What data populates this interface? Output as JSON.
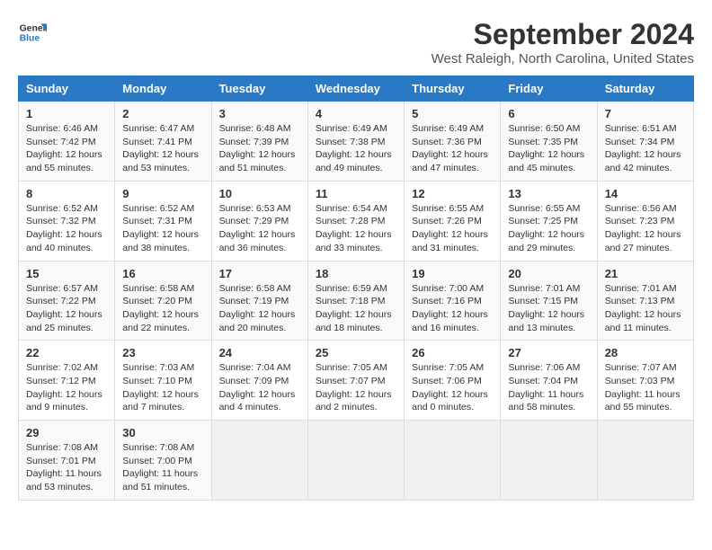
{
  "header": {
    "logo_line1": "General",
    "logo_line2": "Blue",
    "month": "September 2024",
    "location": "West Raleigh, North Carolina, United States"
  },
  "weekdays": [
    "Sunday",
    "Monday",
    "Tuesday",
    "Wednesday",
    "Thursday",
    "Friday",
    "Saturday"
  ],
  "weeks": [
    [
      {
        "day": "1",
        "info": "Sunrise: 6:46 AM\nSunset: 7:42 PM\nDaylight: 12 hours\nand 55 minutes."
      },
      {
        "day": "2",
        "info": "Sunrise: 6:47 AM\nSunset: 7:41 PM\nDaylight: 12 hours\nand 53 minutes."
      },
      {
        "day": "3",
        "info": "Sunrise: 6:48 AM\nSunset: 7:39 PM\nDaylight: 12 hours\nand 51 minutes."
      },
      {
        "day": "4",
        "info": "Sunrise: 6:49 AM\nSunset: 7:38 PM\nDaylight: 12 hours\nand 49 minutes."
      },
      {
        "day": "5",
        "info": "Sunrise: 6:49 AM\nSunset: 7:36 PM\nDaylight: 12 hours\nand 47 minutes."
      },
      {
        "day": "6",
        "info": "Sunrise: 6:50 AM\nSunset: 7:35 PM\nDaylight: 12 hours\nand 45 minutes."
      },
      {
        "day": "7",
        "info": "Sunrise: 6:51 AM\nSunset: 7:34 PM\nDaylight: 12 hours\nand 42 minutes."
      }
    ],
    [
      {
        "day": "8",
        "info": "Sunrise: 6:52 AM\nSunset: 7:32 PM\nDaylight: 12 hours\nand 40 minutes."
      },
      {
        "day": "9",
        "info": "Sunrise: 6:52 AM\nSunset: 7:31 PM\nDaylight: 12 hours\nand 38 minutes."
      },
      {
        "day": "10",
        "info": "Sunrise: 6:53 AM\nSunset: 7:29 PM\nDaylight: 12 hours\nand 36 minutes."
      },
      {
        "day": "11",
        "info": "Sunrise: 6:54 AM\nSunset: 7:28 PM\nDaylight: 12 hours\nand 33 minutes."
      },
      {
        "day": "12",
        "info": "Sunrise: 6:55 AM\nSunset: 7:26 PM\nDaylight: 12 hours\nand 31 minutes."
      },
      {
        "day": "13",
        "info": "Sunrise: 6:55 AM\nSunset: 7:25 PM\nDaylight: 12 hours\nand 29 minutes."
      },
      {
        "day": "14",
        "info": "Sunrise: 6:56 AM\nSunset: 7:23 PM\nDaylight: 12 hours\nand 27 minutes."
      }
    ],
    [
      {
        "day": "15",
        "info": "Sunrise: 6:57 AM\nSunset: 7:22 PM\nDaylight: 12 hours\nand 25 minutes."
      },
      {
        "day": "16",
        "info": "Sunrise: 6:58 AM\nSunset: 7:20 PM\nDaylight: 12 hours\nand 22 minutes."
      },
      {
        "day": "17",
        "info": "Sunrise: 6:58 AM\nSunset: 7:19 PM\nDaylight: 12 hours\nand 20 minutes."
      },
      {
        "day": "18",
        "info": "Sunrise: 6:59 AM\nSunset: 7:18 PM\nDaylight: 12 hours\nand 18 minutes."
      },
      {
        "day": "19",
        "info": "Sunrise: 7:00 AM\nSunset: 7:16 PM\nDaylight: 12 hours\nand 16 minutes."
      },
      {
        "day": "20",
        "info": "Sunrise: 7:01 AM\nSunset: 7:15 PM\nDaylight: 12 hours\nand 13 minutes."
      },
      {
        "day": "21",
        "info": "Sunrise: 7:01 AM\nSunset: 7:13 PM\nDaylight: 12 hours\nand 11 minutes."
      }
    ],
    [
      {
        "day": "22",
        "info": "Sunrise: 7:02 AM\nSunset: 7:12 PM\nDaylight: 12 hours\nand 9 minutes."
      },
      {
        "day": "23",
        "info": "Sunrise: 7:03 AM\nSunset: 7:10 PM\nDaylight: 12 hours\nand 7 minutes."
      },
      {
        "day": "24",
        "info": "Sunrise: 7:04 AM\nSunset: 7:09 PM\nDaylight: 12 hours\nand 4 minutes."
      },
      {
        "day": "25",
        "info": "Sunrise: 7:05 AM\nSunset: 7:07 PM\nDaylight: 12 hours\nand 2 minutes."
      },
      {
        "day": "26",
        "info": "Sunrise: 7:05 AM\nSunset: 7:06 PM\nDaylight: 12 hours\nand 0 minutes."
      },
      {
        "day": "27",
        "info": "Sunrise: 7:06 AM\nSunset: 7:04 PM\nDaylight: 11 hours\nand 58 minutes."
      },
      {
        "day": "28",
        "info": "Sunrise: 7:07 AM\nSunset: 7:03 PM\nDaylight: 11 hours\nand 55 minutes."
      }
    ],
    [
      {
        "day": "29",
        "info": "Sunrise: 7:08 AM\nSunset: 7:01 PM\nDaylight: 11 hours\nand 53 minutes."
      },
      {
        "day": "30",
        "info": "Sunrise: 7:08 AM\nSunset: 7:00 PM\nDaylight: 11 hours\nand 51 minutes."
      },
      {
        "day": "",
        "info": ""
      },
      {
        "day": "",
        "info": ""
      },
      {
        "day": "",
        "info": ""
      },
      {
        "day": "",
        "info": ""
      },
      {
        "day": "",
        "info": ""
      }
    ]
  ]
}
